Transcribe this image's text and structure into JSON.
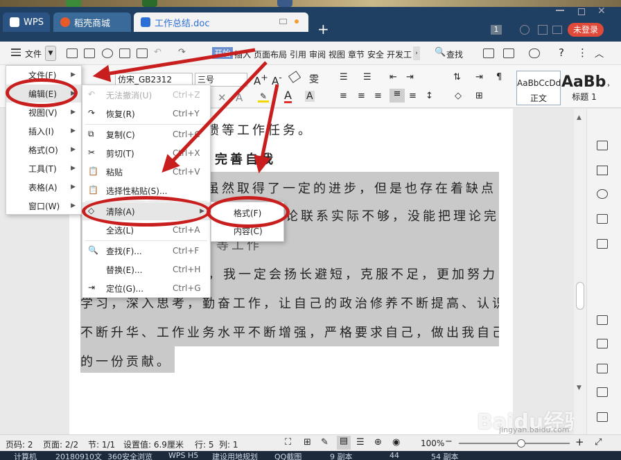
{
  "tabs": [
    {
      "label": "WPS"
    },
    {
      "label": "稻壳商城"
    },
    {
      "label": "工作总结.doc"
    }
  ],
  "window": {
    "badge": "1",
    "login": "未登录"
  },
  "menubar": {
    "file_label": "文件",
    "tabs": [
      "开始",
      "插入",
      "页面布局",
      "引用",
      "审阅",
      "视图",
      "章节",
      "安全",
      "开发工"
    ],
    "search": "查找"
  },
  "ribbon": {
    "font_name": "仿宋_GB2312",
    "font_size": "三号",
    "style_normal_preview": "AaBbCcDd",
    "style_normal": "正文",
    "style_heading_preview": "AaBb",
    "style_heading": "标题 1"
  },
  "file_menu": {
    "items": [
      "文件(F)",
      "编辑(E)",
      "视图(V)",
      "插入(I)",
      "格式(O)",
      "工具(T)",
      "表格(A)",
      "窗口(W)"
    ]
  },
  "edit_menu": {
    "items": [
      {
        "label": "无法撤消(U)",
        "shortcut": "Ctrl+Z"
      },
      {
        "label": "恢复(R)",
        "shortcut": "Ctrl+Y"
      },
      {
        "label": "复制(C)",
        "shortcut": "Ctrl+C"
      },
      {
        "label": "剪切(T)",
        "shortcut": "Ctrl+X"
      },
      {
        "label": "粘贴",
        "shortcut": "Ctrl+V"
      },
      {
        "label": "选择性粘贴(S)...",
        "shortcut": ""
      },
      {
        "label": "清除(A)",
        "shortcut": ""
      },
      {
        "label": "全选(L)",
        "shortcut": "Ctrl+A"
      },
      {
        "label": "查找(F)...",
        "shortcut": "Ctrl+F"
      },
      {
        "label": "替换(E)...",
        "shortcut": "Ctrl+H"
      },
      {
        "label": "定位(G)...",
        "shortcut": "Ctrl+G"
      }
    ]
  },
  "clear_submenu": {
    "items": [
      "格式(F)",
      "内容(C)"
    ]
  },
  "document": {
    "lines": [
      "馈等工作任务。",
      "完善自我",
      "虽然取得了一定的进步，但是也存在着缺点",
      "论联系实际不够，没能把理论完",
      "等工作",
      "，我一定会扬长避短，克服不足，更加努力",
      "学习，深入思考，勤奋工作，让自己的政治修养不断提高、认识",
      "不断升华、工作业务水平不断增强，严格要求自己，做出我自己",
      "的一份贡献。"
    ]
  },
  "statusbar": {
    "page_no": "页码: 2",
    "pages": "页面: 2/2",
    "section": "节: 1/1",
    "setting": "设置值: 6.9厘米",
    "row": "行: 5",
    "col": "列: 1",
    "zoom": "100%"
  },
  "taskbar": {
    "items": [
      "计算机",
      "20180910文",
      "360安全浏览",
      "WPS H5",
      "建设用地规划",
      "QQ截图",
      "9 副本",
      "44",
      "54 副本"
    ]
  },
  "watermark": {
    "text": "Baidu经验",
    "url": "jingyan.baidu.com"
  }
}
